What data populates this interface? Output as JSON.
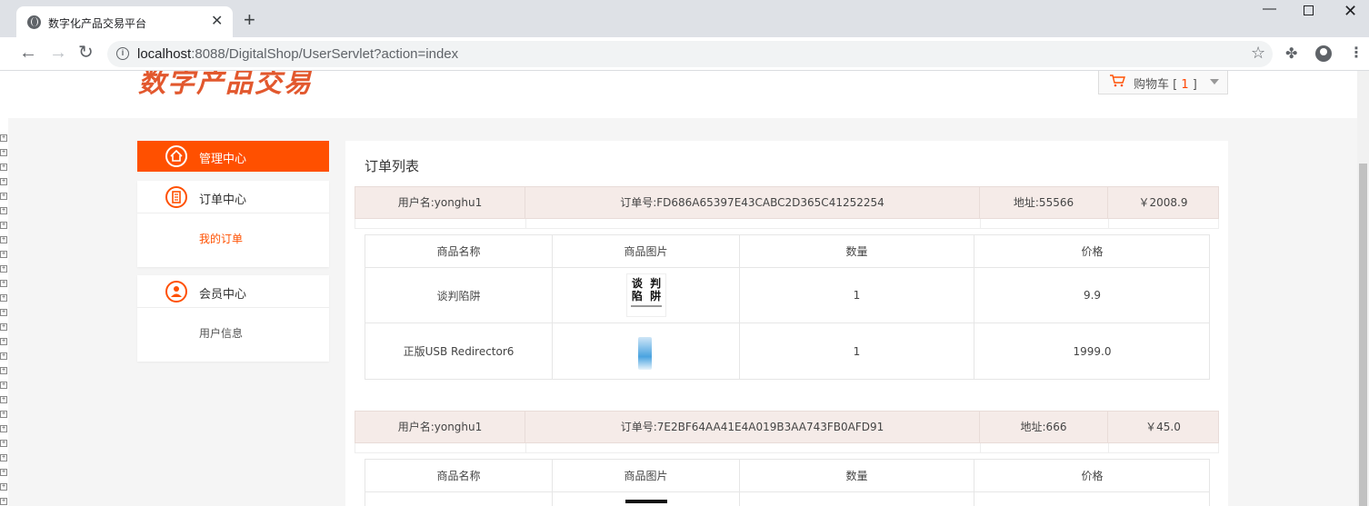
{
  "browser": {
    "tab_title": "数字化产品交易平台",
    "url_host": "localhost",
    "url_path": ":8088/DigitalShop/UserServlet?action=index",
    "icons": [
      "globe-icon",
      "close-icon",
      "plus-icon",
      "back-icon",
      "forward-icon",
      "reload-icon",
      "info-icon",
      "star-icon",
      "extensions-icon",
      "profile-icon",
      "menu-icon"
    ]
  },
  "header": {
    "logo_text": "数字产品交易",
    "cart_label": "购物车",
    "cart_count": "1",
    "accent_color": "#ff5000"
  },
  "sidebar": {
    "admin_center": "管理中心",
    "order_center": "订单中心",
    "my_orders": "我的订单",
    "member_center": "会员中心",
    "user_info": "用户信息"
  },
  "main": {
    "title": "订单列表",
    "columns": {
      "name": "商品名称",
      "image": "商品图片",
      "qty": "数量",
      "price": "价格"
    },
    "orders": [
      {
        "user": "用户名:yonghu1",
        "order_no": "订单号:FD686A65397E43CABC2D365C41252254",
        "address": "地址:55566",
        "total": "￥2008.9",
        "items": [
          {
            "name": "谈判陷阱",
            "image_text": "谈 判 陷 阱",
            "qty": "1",
            "price": "9.9"
          },
          {
            "name": "正版USB Redirector6",
            "qty": "1",
            "price": "1999.0"
          }
        ]
      },
      {
        "user": "用户名:yonghu1",
        "order_no": "订单号:7E2BF64AA41E4A019B3AA743FB0AFD91",
        "address": "地址:666",
        "total": "￥45.0"
      }
    ]
  }
}
